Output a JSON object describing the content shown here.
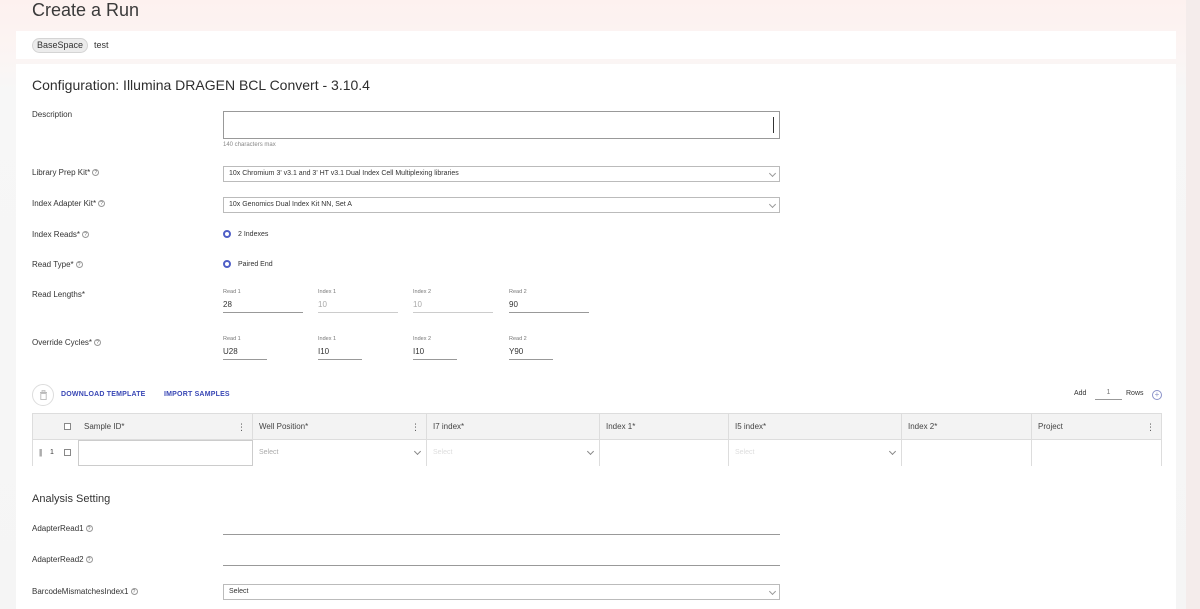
{
  "page": {
    "title": "Create a Run"
  },
  "breadcrumb": {
    "chip": "BaseSpace",
    "text": "test"
  },
  "config": {
    "title": "Configuration: Illumina DRAGEN BCL Convert - 3.10.4",
    "description_label": "Description",
    "description_value": "",
    "description_hint": "140 characters max",
    "library_prep_label": "Library Prep Kit",
    "library_prep_value": "10x Chromium 3' v3.1 and 3' HT v3.1 Dual Index Cell Multiplexing libraries",
    "index_adapter_label": "Index Adapter Kit",
    "index_adapter_value": "10x Genomics Dual Index Kit NN, Set A",
    "index_reads_label": "Index Reads",
    "index_reads_value": "2 Indexes",
    "read_type_label": "Read Type",
    "read_type_value": "Paired End",
    "read_lengths_label": "Read Lengths",
    "read_lengths": [
      {
        "caption": "Read 1",
        "value": "28",
        "disabled": false
      },
      {
        "caption": "Index 1",
        "value": "10",
        "disabled": true
      },
      {
        "caption": "Index 2",
        "value": "10",
        "disabled": true
      },
      {
        "caption": "Read 2",
        "value": "90",
        "disabled": false
      }
    ],
    "override_cycles_label": "Override Cycles",
    "override_cycles": [
      {
        "caption": "Read 1",
        "value": "U28"
      },
      {
        "caption": "Index 1",
        "value": "I10"
      },
      {
        "caption": "Index 2",
        "value": "I10"
      },
      {
        "caption": "Read 2",
        "value": "Y90"
      }
    ],
    "required_mark": "*",
    "help_mark": "?"
  },
  "toolbar": {
    "download_template": "DOWNLOAD TEMPLATE",
    "import_samples": "IMPORT SAMPLES",
    "add_label": "Add",
    "rows_value": "1",
    "rows_label": "Rows"
  },
  "grid": {
    "headers": [
      "Sample ID*",
      "Well Position*",
      "I7 index*",
      "Index 1*",
      "I5 index*",
      "Index 2*",
      "Project"
    ],
    "row_number": "1",
    "select_placeholder": "Select",
    "select_placeholder_muted": "Select"
  },
  "analysis": {
    "title": "Analysis Setting",
    "adapter_read1_label": "AdapterRead1",
    "adapter_read2_label": "AdapterRead2",
    "barcode_mismatches_label": "BarcodeMismatchesIndex1",
    "barcode_mismatches_value": "Select"
  },
  "icons": {
    "delete": "trash-icon",
    "add": "plus-circle-icon",
    "menu": "kebab-menu-icon",
    "drag": "drag-handle-icon",
    "dropdown": "chevron-down-icon",
    "help": "help-icon"
  },
  "colors": {
    "accent": "#3947b5",
    "radio": "#4f5fc7"
  }
}
